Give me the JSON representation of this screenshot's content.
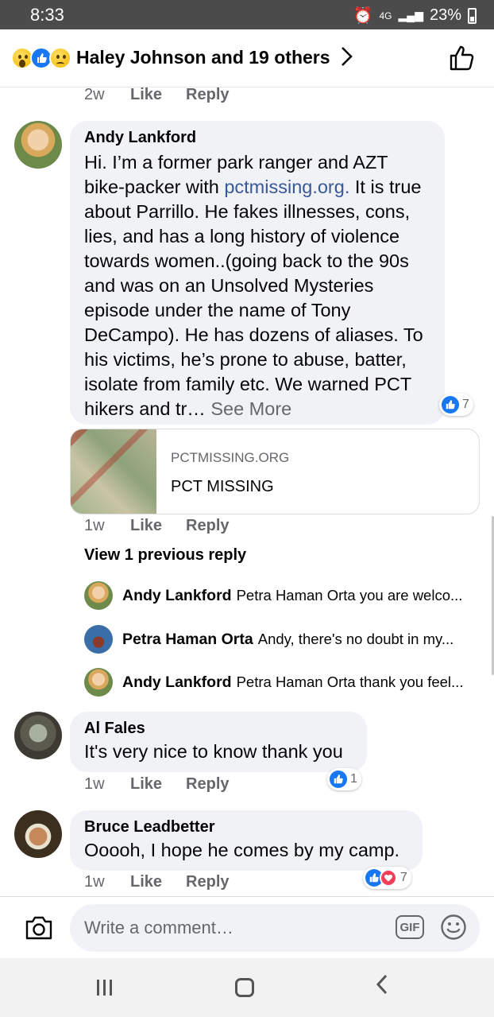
{
  "status": {
    "time": "8:33",
    "network": "4G",
    "battery": "23%"
  },
  "header": {
    "title": "Haley Johnson and 19 others"
  },
  "top_meta": {
    "time": "2w",
    "like": "Like",
    "reply": "Reply"
  },
  "comments": [
    {
      "name": "Andy Lankford",
      "text_before": "Hi. I’m a former park ranger and AZT bike-packer with ",
      "link": "pctmissing.org.",
      "text_after": " It is true about Parrillo. He fakes illnesses, cons, lies, and has a long history of violence towards women..(going back to the 90s and was on an Unsolved Mysteries episode under the name of Tony DeCampo).  He has dozens of aliases. To his victims, he’s prone to abuse, batter, isolate from family etc. We warned PCT hikers and tr…",
      "see_more": "See More",
      "reactions": "7",
      "link_preview": {
        "domain": "PCTMISSING.ORG",
        "title": "PCT MISSING"
      },
      "time": "1w",
      "like": "Like",
      "reply": "Reply"
    },
    {
      "name": "Al Fales",
      "text": "It's very nice to know thank you",
      "reactions": "1",
      "time": "1w",
      "like": "Like",
      "reply": "Reply"
    },
    {
      "name": "Bruce Leadbetter",
      "text": "Ooooh, I hope he comes by my camp.",
      "reactions": "7",
      "time": "1w",
      "like": "Like",
      "reply": "Reply"
    }
  ],
  "view_previous": "View 1 previous reply",
  "replies": [
    {
      "name": "Andy Lankford",
      "text": "Petra Haman Orta you are welco..."
    },
    {
      "name": "Petra Haman Orta",
      "text": "Andy, there's no doubt in my..."
    },
    {
      "name": "Andy Lankford",
      "text": "Petra Haman Orta thank you feel..."
    }
  ],
  "composer": {
    "placeholder": "Write a comment…",
    "gif": "GIF"
  },
  "colors": {
    "like_blue": "#1877f2",
    "link_blue": "#385898",
    "love_red": "#f33e58",
    "bubble_gray": "#f0f2f5"
  },
  "icons": [
    "wow-reaction-icon",
    "like-reaction-icon",
    "sad-reaction-icon",
    "chevron-right-icon",
    "thumbs-up-icon",
    "camera-icon",
    "gif-icon",
    "emoji-icon",
    "love-reaction-icon"
  ]
}
